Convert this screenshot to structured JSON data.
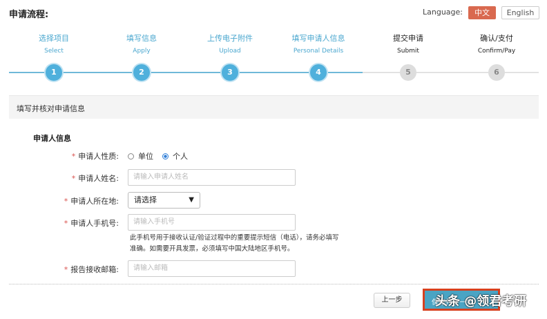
{
  "header": {
    "title": "申请流程:",
    "language_label": "Language:",
    "lang_zh": "中文",
    "lang_en": "English"
  },
  "steps": [
    {
      "cn": "选择项目",
      "en": "Select",
      "num": "1",
      "state": "done"
    },
    {
      "cn": "填写信息",
      "en": "Apply",
      "num": "2",
      "state": "done"
    },
    {
      "cn": "上传电子附件",
      "en": "Upload",
      "num": "3",
      "state": "done"
    },
    {
      "cn": "填写申请人信息",
      "en": "Personal Details",
      "num": "4",
      "state": "current"
    },
    {
      "cn": "提交申请",
      "en": "Submit",
      "num": "5",
      "state": "todo"
    },
    {
      "cn": "确认/支付",
      "en": "Confirm/Pay",
      "num": "6",
      "state": "todo"
    }
  ],
  "colors": {
    "accent": "#4fb0dc",
    "lang_active": "#d9694f",
    "required": "#d9534f"
  },
  "section": {
    "band_title": "填写并核对申请信息",
    "title": "申请人信息"
  },
  "form": {
    "required_mark": "*",
    "type_label": "申请人性质:",
    "type_options": [
      "单位",
      "个人"
    ],
    "type_selected": "个人",
    "name_label": "申请人姓名:",
    "name_placeholder": "请输入申请人姓名",
    "location_label": "申请人所在地:",
    "location_value": "请选择",
    "phone_label": "申请人手机号:",
    "phone_placeholder": "请输入手机号",
    "phone_help_1": "此手机号用于接收认证/验证过程中的重要提示短信（电话），请务必填写",
    "phone_help_2": "准确。如需要开具发票，必须填写中国大陆地区手机号。",
    "email_label": "报告接收邮箱:",
    "email_placeholder": "请输入邮箱"
  },
  "actions": {
    "prev": "上一步",
    "save": "保存并下一步"
  },
  "watermark": "头条 @领君考研"
}
